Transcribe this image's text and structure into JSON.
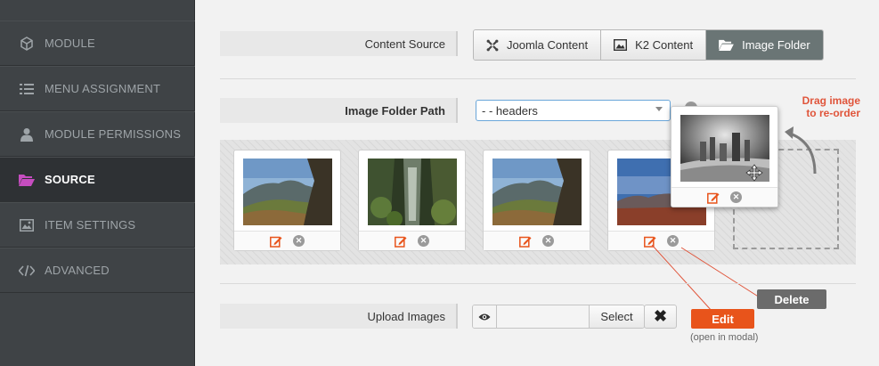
{
  "sidebar": {
    "items": [
      {
        "label": "MODULE",
        "icon": "module-icon"
      },
      {
        "label": "MENU ASSIGNMENT",
        "icon": "list-icon"
      },
      {
        "label": "MODULE PERMISSIONS",
        "icon": "user-icon"
      },
      {
        "label": "SOURCE",
        "icon": "folder-open-icon",
        "active": true
      },
      {
        "label": "ITEM SETTINGS",
        "icon": "image-icon"
      },
      {
        "label": "ADVANCED",
        "icon": "code-icon"
      }
    ]
  },
  "content_source": {
    "label": "Content Source",
    "options": [
      {
        "label": "Joomla Content",
        "icon": "joomla-icon"
      },
      {
        "label": "K2 Content",
        "icon": "image-icon"
      },
      {
        "label": "Image Folder",
        "icon": "folder-open-icon",
        "active": true
      }
    ]
  },
  "image_folder_path": {
    "label": "Image Folder Path",
    "value": "- - headers"
  },
  "gallery": {
    "images": [
      {
        "subject": "mountain-valley-cliff"
      },
      {
        "subject": "forest-waterfall"
      },
      {
        "subject": "mountain-valley-cliff"
      },
      {
        "subject": "red-desert-mountains"
      }
    ],
    "dragging_image": {
      "subject": "desert-pinnacles-grayscale"
    }
  },
  "annotations": {
    "drag_hint": [
      "Drag image",
      "to re-order"
    ],
    "edit": "Edit",
    "edit_note": "(open in modal)",
    "delete": "Delete"
  },
  "upload_images": {
    "label": "Upload Images",
    "select_label": "Select",
    "clear_symbol": "✖"
  },
  "colors": {
    "accent_orange": "#e8541b",
    "annotation_red": "#e0553b",
    "active_purple": "#c64dc0",
    "sidebar_bg": "#3f4346",
    "delete_gray": "#6b6b6b"
  }
}
